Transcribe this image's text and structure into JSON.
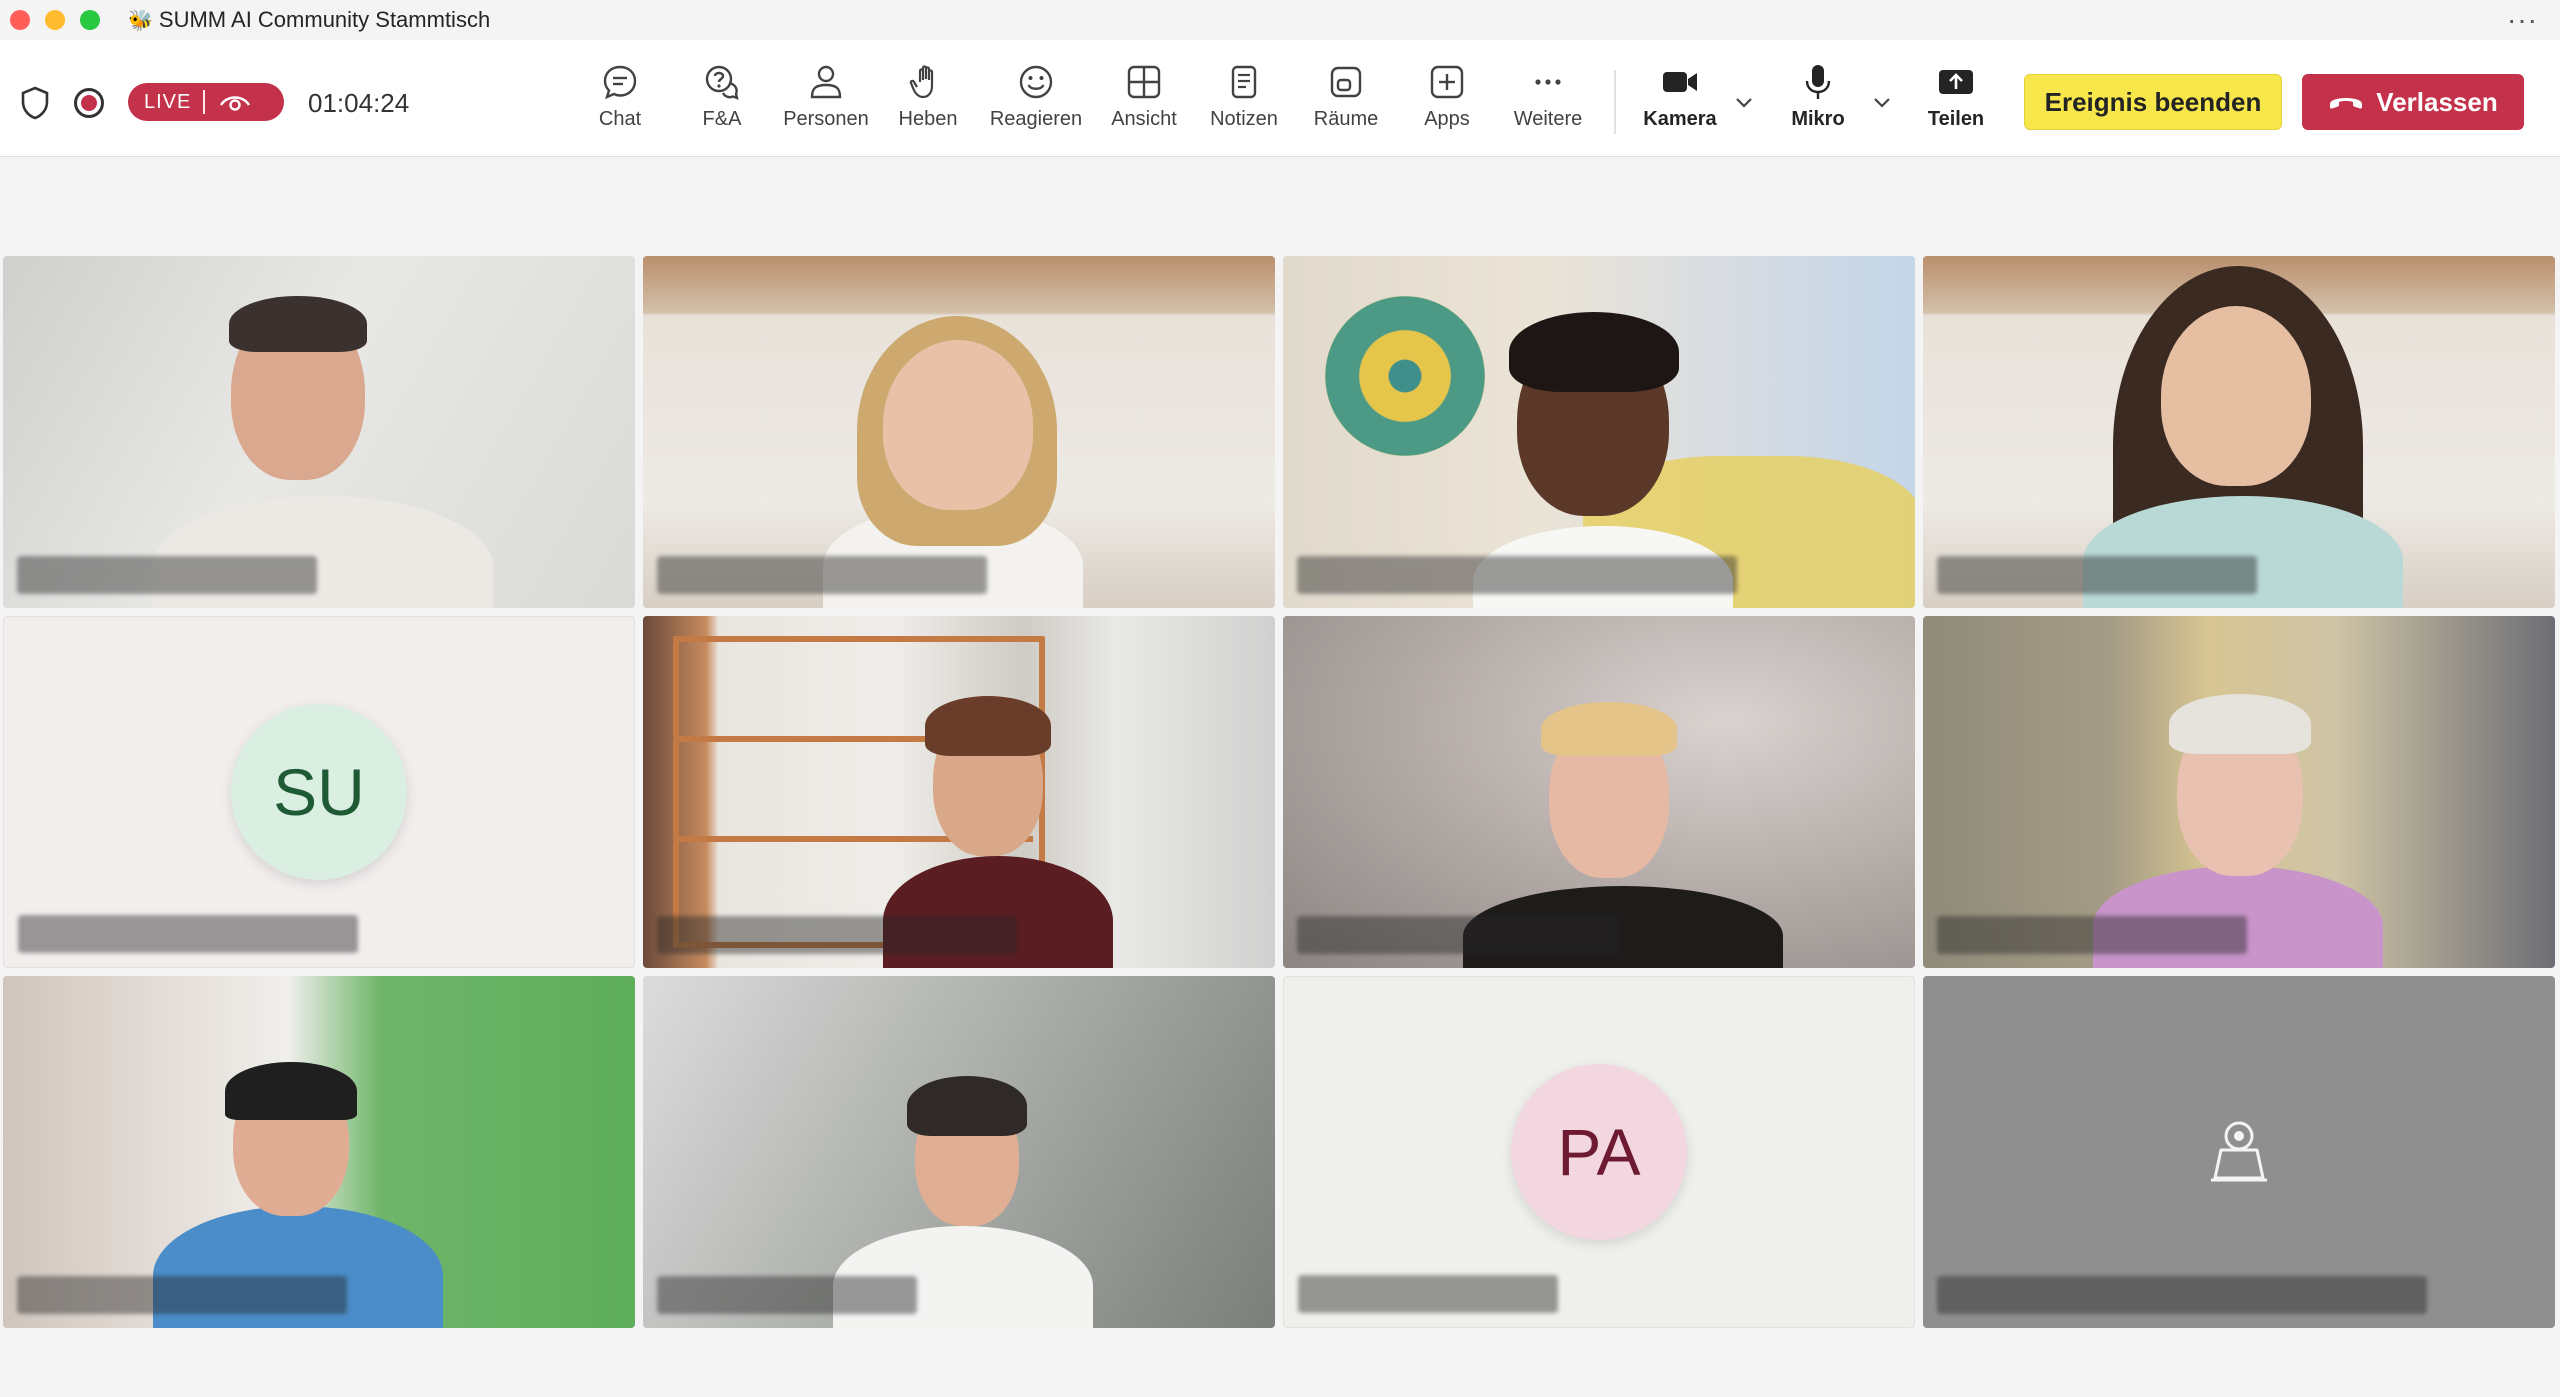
{
  "window": {
    "title": "SUMM AI Community Stammtisch",
    "more_label": "···"
  },
  "meeting": {
    "live_label": "LIVE",
    "timer": "01:04:24"
  },
  "toolbar": {
    "buttons": [
      {
        "label": "Chat",
        "icon": "chat-icon"
      },
      {
        "label": "F&A",
        "icon": "qa-icon"
      },
      {
        "label": "Personen",
        "icon": "people-icon"
      },
      {
        "label": "Heben",
        "icon": "raise-hand-icon"
      },
      {
        "label": "Reagieren",
        "icon": "smile-icon"
      },
      {
        "label": "Ansicht",
        "icon": "grid-view-icon"
      },
      {
        "label": "Notizen",
        "icon": "notes-icon"
      },
      {
        "label": "Räume",
        "icon": "rooms-icon"
      },
      {
        "label": "Apps",
        "icon": "apps-plus-icon"
      },
      {
        "label": "Weitere",
        "icon": "more-icon"
      },
      {
        "label": "Kamera",
        "icon": "camera-icon"
      },
      {
        "label": "Mikro",
        "icon": "microphone-icon"
      },
      {
        "label": "Teilen",
        "icon": "share-icon"
      }
    ],
    "end_event_label": "Ereignis beenden",
    "leave_label": "Verlassen"
  },
  "participants": [
    {
      "type": "video"
    },
    {
      "type": "video"
    },
    {
      "type": "video"
    },
    {
      "type": "video"
    },
    {
      "type": "avatar",
      "initials": "SU"
    },
    {
      "type": "video"
    },
    {
      "type": "video"
    },
    {
      "type": "video"
    },
    {
      "type": "video"
    },
    {
      "type": "video"
    },
    {
      "type": "avatar",
      "initials": "PA"
    },
    {
      "type": "camera-off"
    }
  ],
  "colors": {
    "live_red": "#c4314b",
    "end_yellow": "#f8e74a",
    "leave_red": "#c4314b",
    "su_avatar_bg": "#dbeee2",
    "su_avatar_text": "#1e5b35",
    "pa_avatar_bg": "#f2d7e0",
    "pa_avatar_text": "#6e1a33"
  }
}
